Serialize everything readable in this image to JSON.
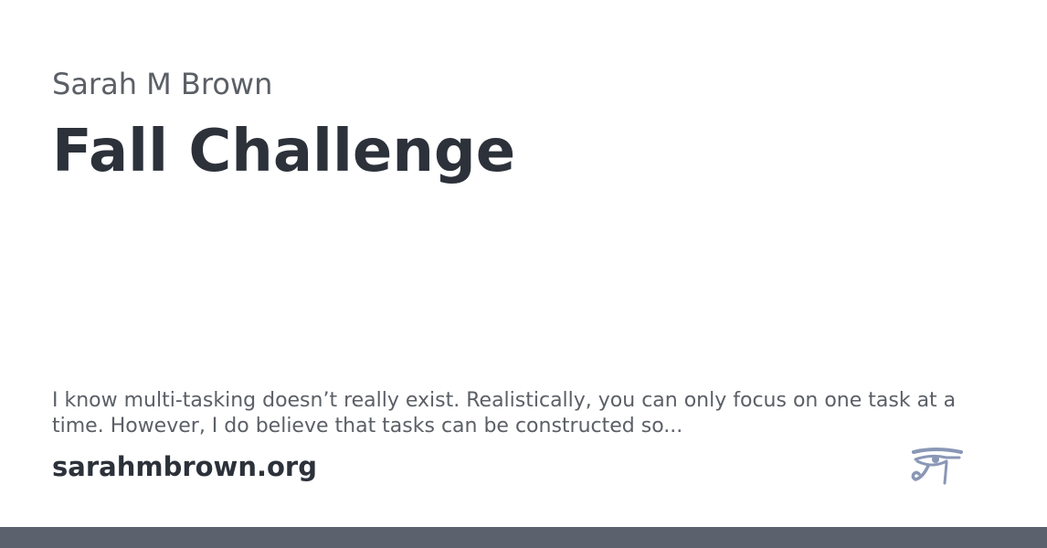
{
  "card": {
    "author": "Sarah M Brown",
    "title": "Fall Challenge",
    "excerpt": "I know multi-tasking doesn’t really exist.  Realistically, you can only focus on one task at a time.  However, I do believe that tasks can be constructed so...",
    "domain": "sarahmbrown.org",
    "logo_icon": "eye-of-horus-icon"
  },
  "colors": {
    "background": "#ffffff",
    "title": "#2c313a",
    "secondary_text": "#5b5f66",
    "logo": "#8a97b5",
    "footer_bar": "#5b616d"
  }
}
